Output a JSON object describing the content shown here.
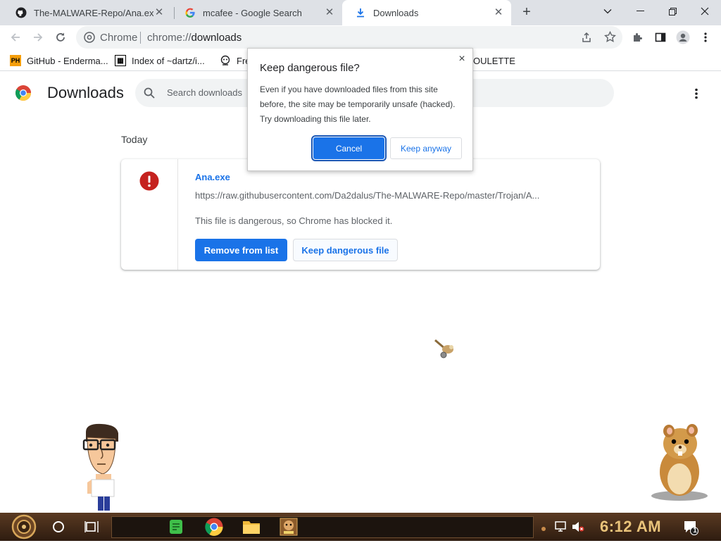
{
  "tabs": [
    {
      "title": "The-MALWARE-Repo/Ana.exe",
      "favicon": "github-icon",
      "active": false
    },
    {
      "title": "mcafee - Google Search",
      "favicon": "google-icon",
      "active": false
    },
    {
      "title": "Downloads",
      "favicon": "download-icon",
      "active": true
    }
  ],
  "new_tab_label": "+",
  "window_controls": {
    "minimize": "–",
    "restore": "❐",
    "close": "✕",
    "tab_search": "⌄"
  },
  "toolbar": {
    "omnibox_chip": "Chrome",
    "url_scheme": "chrome://",
    "url_host": "downloads"
  },
  "bookmarks": [
    {
      "label": "GitHub - Enderma...",
      "icon_text": "PH"
    },
    {
      "label": "Index of ~dartz/i...",
      "icon_text": "▦"
    },
    {
      "label": "Fre",
      "icon_text": ""
    },
    {
      "label": "OULETTE",
      "icon_text": ""
    }
  ],
  "page": {
    "title": "Downloads",
    "search_placeholder": "Search downloads",
    "date_header": "Today"
  },
  "download": {
    "file_name": "Ana.exe",
    "url": "https://raw.githubusercontent.com/Da2dalus/The-MALWARE-Repo/master/Trojan/A...",
    "status": "This file is dangerous, so Chrome has blocked it.",
    "remove_label": "Remove from list",
    "keep_label": "Keep dangerous file"
  },
  "dialog": {
    "title": "Keep dangerous file?",
    "body": "Even if you have downloaded files from this site before, the site may be temporarily unsafe (hacked). Try downloading this file later.",
    "cancel_label": "Cancel",
    "keep_label": "Keep anyway",
    "close_glyph": "×"
  },
  "taskbar": {
    "clock": "6:12 AM",
    "notification_count": "1"
  },
  "colors": {
    "accent": "#1a73e8",
    "danger": "#c5221f",
    "taskbar": "#3b2616"
  }
}
